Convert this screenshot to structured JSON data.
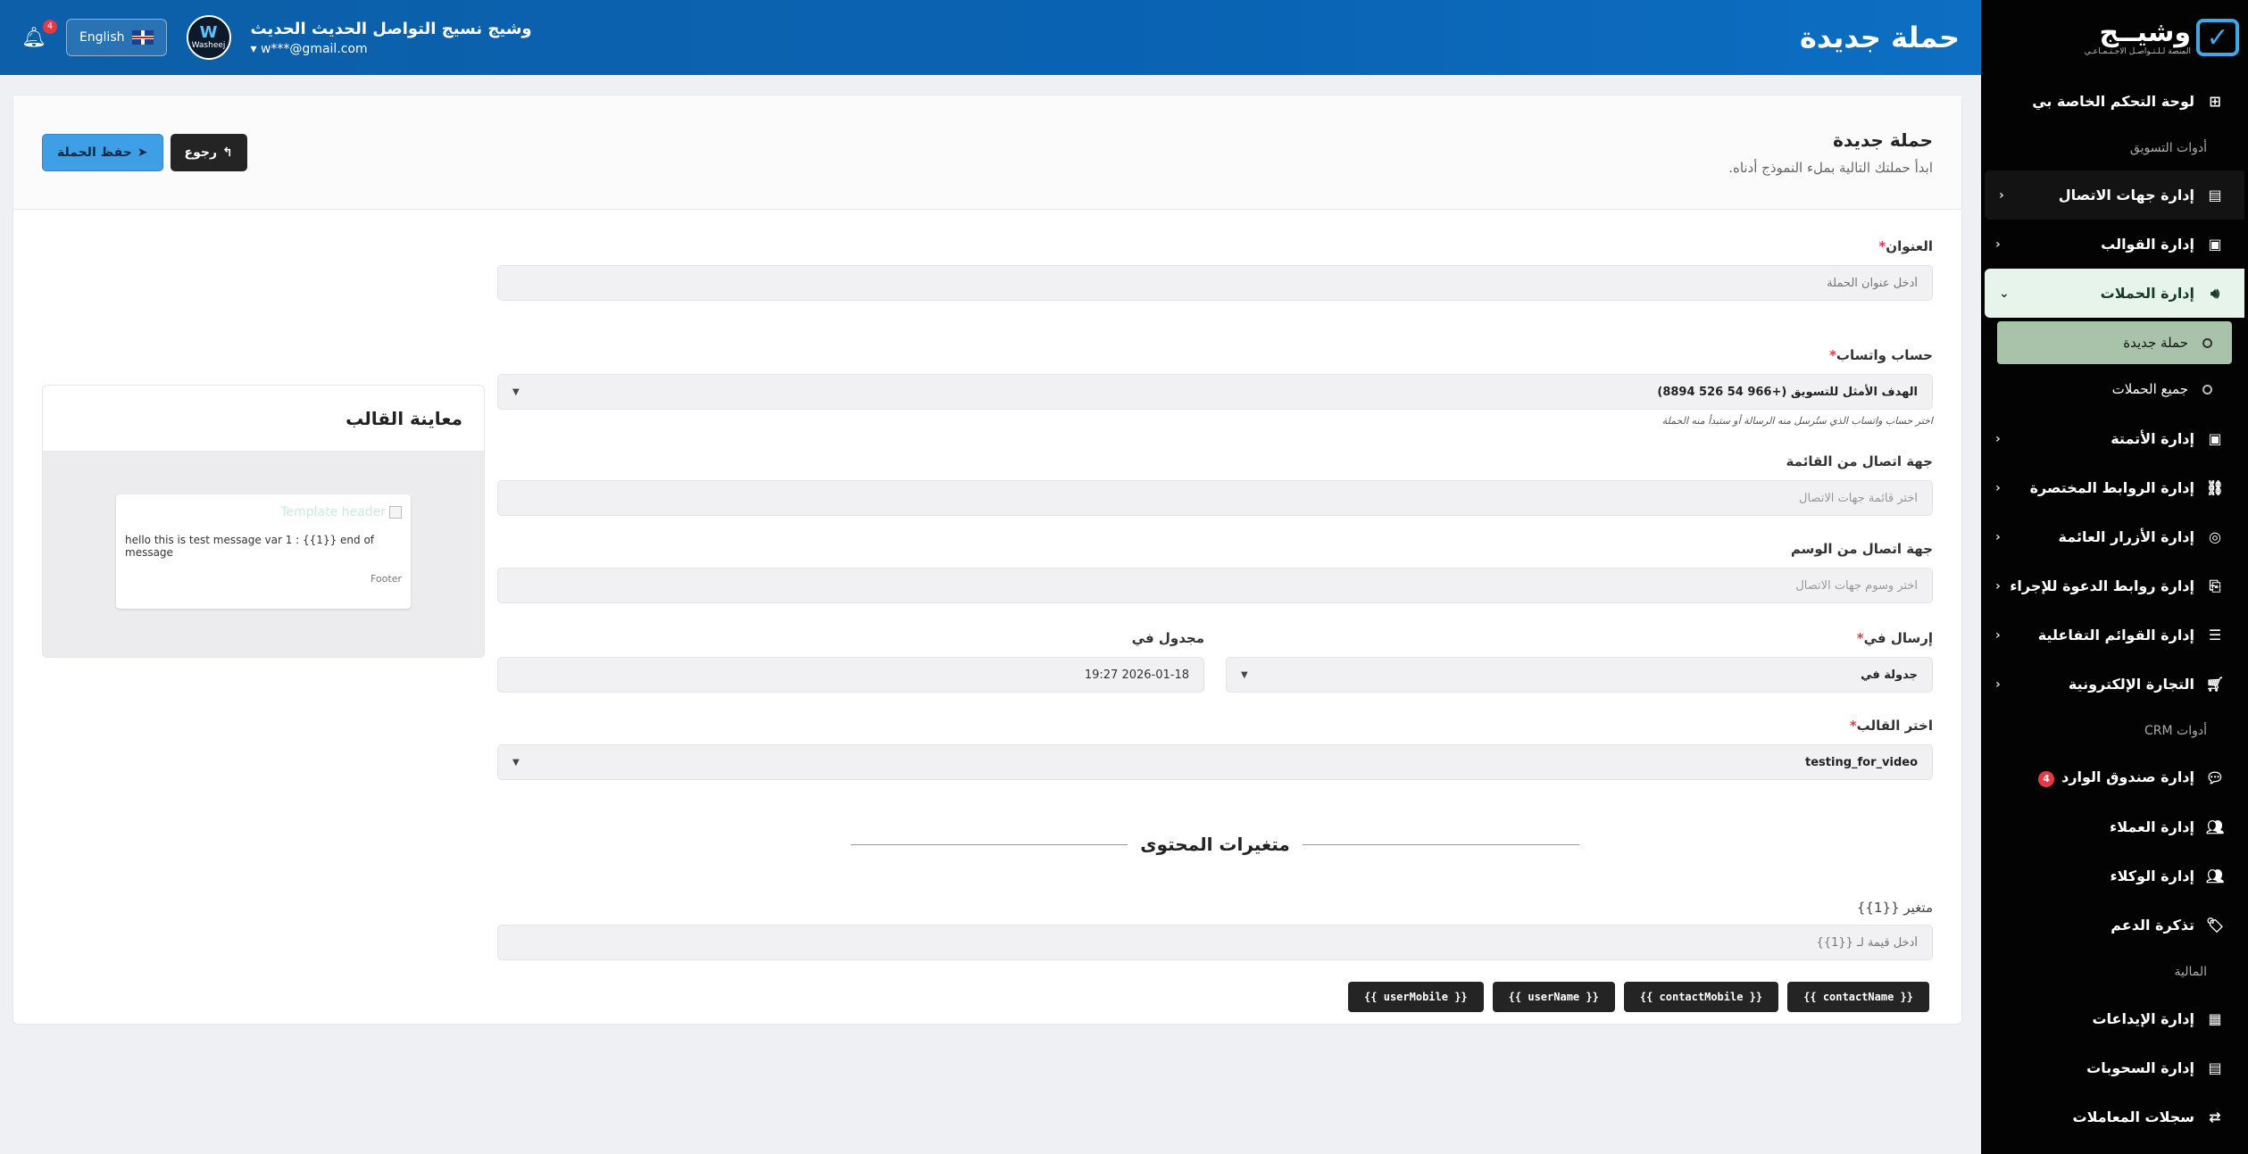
{
  "header": {
    "title": "حملة جديدة",
    "user_name": "وشيج نسيج التواصل الحديث الحديث",
    "user_email": "w***@gmail.com",
    "lang_label": "English",
    "notif_count": "4",
    "avatar_label": "Washeej"
  },
  "sidebar": {
    "logo_text": "وشيــج",
    "logo_sub": "المنصة لـلـتـواصـل الاجـتـمـاعـي",
    "dashboard": "لوحة التحكم الخاصة بي",
    "section_marketing": "أدوات التسويق",
    "contacts": "إدارة جهات الاتصال",
    "templates": "إدارة القوالب",
    "campaigns": "إدارة الحملات",
    "new_campaign": "حملة جديدة",
    "all_campaigns": "جميع الحملات",
    "automation": "إدارة الأتمتة",
    "short_links": "إدارة الروابط المختصرة",
    "floating_buttons": "إدارة الأزرار العائمة",
    "cta_links": "إدارة روابط الدعوة للإجراء",
    "interactive_lists": "إدارة القوائم التفاعلية",
    "ecommerce": "التجارة الإلكترونية",
    "section_crm": "أدوات CRM",
    "inbox": "إدارة صندوق الوارد",
    "inbox_count": "4",
    "customers": "إدارة العملاء",
    "agents": "إدارة الوكلاء",
    "support": "تذكرة الدعم",
    "section_finance": "المالية",
    "deposits": "إدارة الإيداعات",
    "withdrawals": "إدارة السحوبات",
    "transactions": "سجلات المعاملات"
  },
  "card": {
    "title": "حملة جديدة",
    "subtitle": "ابدأ حملتك التالية بملء النموذج أدناه.",
    "back_label": "رجوع",
    "save_label": "حفظ الحملة"
  },
  "form": {
    "title_label": "العنوان",
    "title_placeholder": "أدخل عنوان الحملة",
    "whatsapp_label": "حساب واتساب",
    "whatsapp_value": "الهدف الأمثل للتسويق (+966 54 526 8894)",
    "whatsapp_hint": "اختر حساب واتساب الذي ستُرسل منه الرسالة أو ستبدأ منه الحملة",
    "contact_list_label": "جهة اتصال من القائمة",
    "contact_list_placeholder": "اختر قائمة جهات الاتصال",
    "contact_tag_label": "جهة اتصال من الوسم",
    "contact_tag_placeholder": "اختر وسوم جهات الاتصال",
    "send_in_label": "إرسال في",
    "send_in_value": "جدولة في",
    "scheduled_label": "مجدول في",
    "scheduled_value": "2026-01-18 19:27",
    "template_label": "اختر القالب",
    "template_value": "testing_for_video",
    "content_vars_title": "متغيرات المحتوى",
    "var1_label": "متغير {{1}}",
    "var1_placeholder": "أدخل قيمة لـ {{1}}",
    "tags": [
      "{{ contactName }}",
      "{{ contactMobile }}",
      "{{ userName }}",
      "{{ userMobile }}"
    ]
  },
  "preview": {
    "title": "معاينة القالب",
    "header_text": "Template header",
    "body_text": "hello this is test message var 1 : {{1}} end of message",
    "footer_text": "Footer"
  }
}
